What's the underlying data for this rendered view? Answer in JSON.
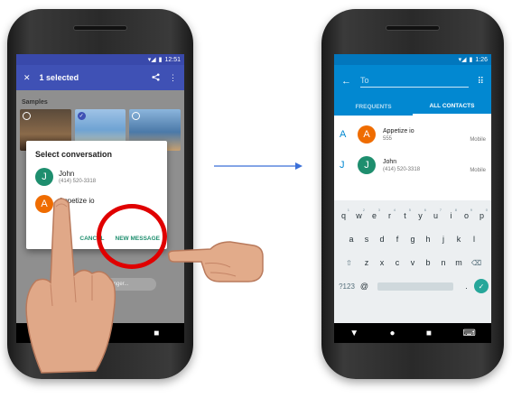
{
  "left_phone": {
    "status_time": "12:51",
    "appbar": {
      "close_icon": "close-icon",
      "title": "1 selected",
      "share_icon": "share-icon",
      "more_icon": "more-vert-icon"
    },
    "section_label": "Samples",
    "dialog": {
      "title": "Select conversation",
      "items": [
        {
          "initial": "J",
          "name": "John",
          "number": "(414) 520-3318",
          "color": "#1e8e6e"
        },
        {
          "initial": "A",
          "name": "Appetize io",
          "number": "555",
          "color": "#ef6c00"
        }
      ],
      "cancel_label": "CANCEL",
      "new_message_label": "NEW MESSAGE"
    },
    "messenger_label": "essenger..."
  },
  "right_phone": {
    "status_time": "1:26",
    "to_placeholder": "To",
    "tabs": [
      {
        "label": "FREQUENTS"
      },
      {
        "label": "ALL CONTACTS"
      }
    ],
    "contacts": [
      {
        "section": "A",
        "initial": "A",
        "name": "Appetize io",
        "number": "555",
        "type": "Mobile",
        "color": "#ef6c00"
      },
      {
        "section": "J",
        "initial": "J",
        "name": "John",
        "number": "(414) 520-3318",
        "type": "Mobile",
        "color": "#1e8e6e"
      }
    ],
    "keyboard": {
      "row1": [
        "q",
        "w",
        "e",
        "r",
        "t",
        "y",
        "u",
        "i",
        "o",
        "p"
      ],
      "row1_hints": [
        "1",
        "2",
        "3",
        "4",
        "5",
        "6",
        "7",
        "8",
        "9",
        "0"
      ],
      "row2": [
        "a",
        "s",
        "d",
        "f",
        "g",
        "h",
        "j",
        "k",
        "l"
      ],
      "row3": [
        "z",
        "x",
        "c",
        "v",
        "b",
        "n",
        "m"
      ],
      "symbols_label": "?123",
      "at_label": "@",
      "period_label": "."
    }
  },
  "colors": {
    "accent_red": "#e00000",
    "indigo": "#3f51b5",
    "blue": "#0288d1",
    "teal": "#1e8e6e"
  }
}
